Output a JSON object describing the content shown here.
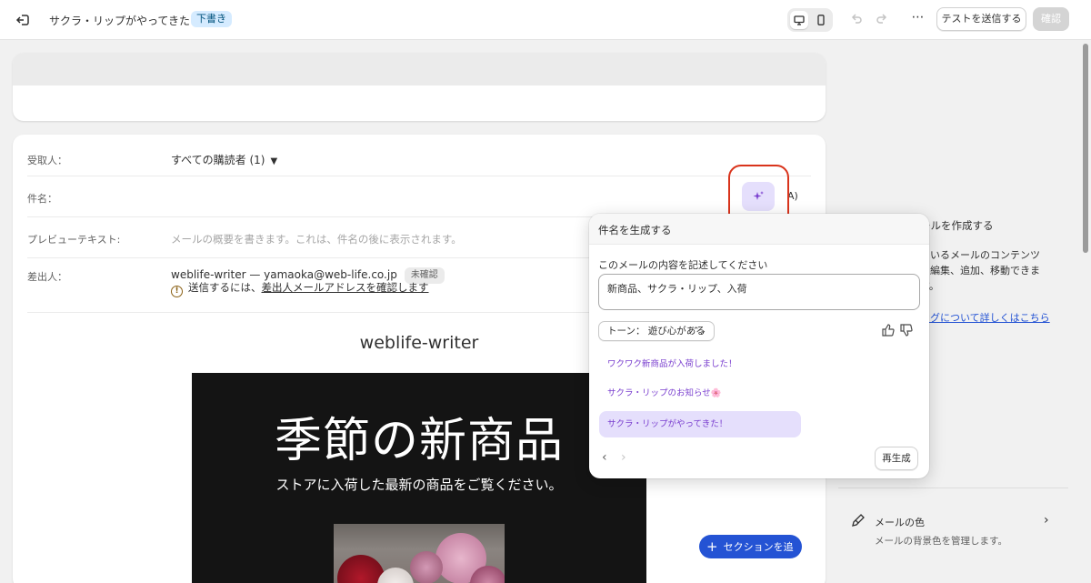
{
  "topbar": {
    "title": "サクラ・リップがやってきた！",
    "status_badge": "下書き",
    "test_send_label": "テストを送信する",
    "confirm_label": "確認",
    "more_label": "⋯"
  },
  "form": {
    "recipient": {
      "label": "受取人：",
      "value": "すべての購読者 (1)"
    },
    "subject": {
      "label": "件名：",
      "tail": "A)"
    },
    "preview_text": {
      "label": "プレビューテキスト:",
      "placeholder": "メールの概要を書きます。これは、件名の後に表示されます。"
    },
    "sender": {
      "label": "差出人：",
      "value": "weblife-writer — yamaoka@web-life.co.jp",
      "badge": "未確認",
      "warning_prefix": "送信するには、",
      "warning_link": "差出人メールアドレスを確認します"
    }
  },
  "email_preview": {
    "sender_name": "weblife-writer",
    "hero_title": "季節の新商品",
    "hero_subtitle": "ストアに入荷した最新の商品をご覧ください。"
  },
  "add_section_label": "セクションを追加",
  "right_panel": {
    "title": "ールを作成する",
    "description": "ているメールのコンテンツ\nに編集、追加、移動できま\nす。",
    "link": "ングについて詳しくはこちら",
    "email_color": {
      "title": "メールの色",
      "description": "メールの背景色を管理します。"
    }
  },
  "popover": {
    "title": "件名を生成する",
    "prompt_label": "このメールの内容を記述してください",
    "prompt_value": "新商品、サクラ・リップ、入荷",
    "tone_label": "トーン： 遊び心がある",
    "suggestions": [
      "ワクワク新商品が入荷しました！",
      "サクラ・リップのお知らせ🌸",
      "サクラ・リップがやってきた！"
    ],
    "selected_index": 2,
    "regenerate_label": "再生成"
  },
  "colors": {
    "accent": "#2453d4",
    "ai_purple": "#7a3fcf",
    "ai_bg": "#e5dffc",
    "highlight": "#d9341c"
  }
}
